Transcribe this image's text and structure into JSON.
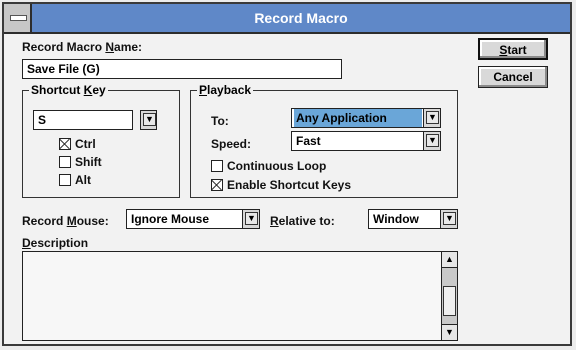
{
  "window": {
    "title": "Record Macro"
  },
  "macro_name": {
    "label_pre": "Record Macro ",
    "label_u": "N",
    "label_post": "ame:",
    "value": "Save File (G)"
  },
  "shortcut_key": {
    "label_pre": "Shortcut ",
    "label_u": "K",
    "label_post": "ey",
    "value": "S",
    "ctrl": {
      "label": "Ctrl",
      "checked": true
    },
    "shift": {
      "label": "Shift",
      "checked": false
    },
    "alt": {
      "label": "Alt",
      "checked": false
    }
  },
  "playback": {
    "label_u": "P",
    "label_post": "layback",
    "to_label": "To:",
    "to_value": "Any Application",
    "speed_label": "Speed:",
    "speed_value": "Fast",
    "continuous_loop": {
      "label": "Continuous Loop",
      "checked": false
    },
    "enable_shortcut_keys": {
      "label": "Enable Shortcut Keys",
      "checked": true
    }
  },
  "record_mouse": {
    "label_pre": "Record ",
    "label_u": "M",
    "label_post": "ouse:",
    "value": "Ignore Mouse"
  },
  "relative_to": {
    "label_u": "R",
    "label_post": "elative to:",
    "value": "Window"
  },
  "description": {
    "label_u": "D",
    "label_post": "escription",
    "value": ""
  },
  "buttons": {
    "start_u": "S",
    "start_post": "tart",
    "cancel": "Cancel"
  },
  "icons": {
    "dropdown": "down-arrow",
    "scroll_up": "up-arrow",
    "scroll_down": "down-arrow"
  }
}
